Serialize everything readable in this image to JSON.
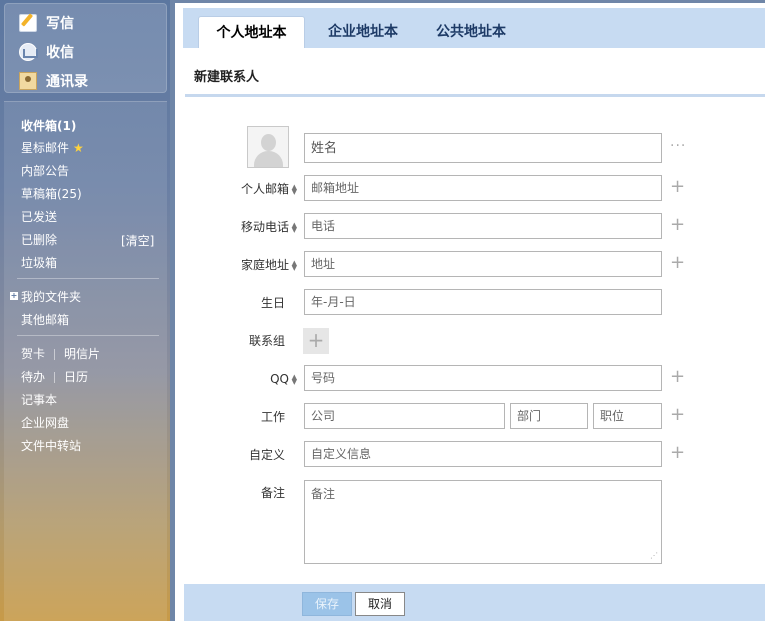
{
  "sidebar": {
    "actions": {
      "compose": "写信",
      "receive": "收信",
      "contacts": "通讯录"
    },
    "folders": {
      "inbox": "收件箱(1)",
      "starred": "星标邮件",
      "announcement": "内部公告",
      "drafts": "草稿箱(25)",
      "sent": "已发送",
      "deleted": "已删除",
      "clear": "[清空]",
      "spam": "垃圾箱"
    },
    "my_folders": "我的文件夹",
    "other_mailbox": "其他邮箱",
    "tools": {
      "greeting_card": "贺卡",
      "postcard": "明信片",
      "todo": "待办",
      "calendar": "日历",
      "notepad": "记事本",
      "cloud_disk": "企业网盘",
      "file_transfer": "文件中转站"
    }
  },
  "tabs": [
    {
      "label": "个人地址本",
      "active": true
    },
    {
      "label": "企业地址本",
      "active": false
    },
    {
      "label": "公共地址本",
      "active": false
    }
  ],
  "form": {
    "title": "新建联系人",
    "name_placeholder": "姓名",
    "email": {
      "label": "个人邮箱",
      "placeholder": "邮箱地址"
    },
    "mobile": {
      "label": "移动电话",
      "placeholder": "电话"
    },
    "home_address": {
      "label": "家庭地址",
      "placeholder": "地址"
    },
    "birthday": {
      "label": "生日",
      "placeholder": "年-月-日"
    },
    "group": {
      "label": "联系组"
    },
    "qq": {
      "label": "QQ",
      "placeholder": "号码"
    },
    "work": {
      "label": "工作",
      "company_placeholder": "公司",
      "department_placeholder": "部门",
      "position_placeholder": "职位"
    },
    "custom": {
      "label": "自定义",
      "placeholder": "自定义信息"
    },
    "notes": {
      "label": "备注",
      "placeholder": "备注"
    }
  },
  "buttons": {
    "save": "保存",
    "cancel": "取消"
  }
}
